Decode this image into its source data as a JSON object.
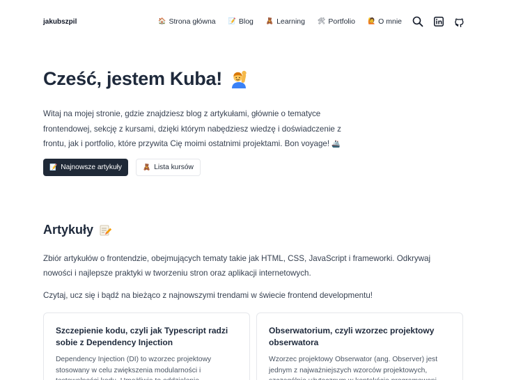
{
  "header": {
    "brand": "jakubszpil",
    "nav": [
      {
        "label": "Strona główna",
        "icon": "house-icon",
        "emoji": "🏠"
      },
      {
        "label": "Blog",
        "icon": "memo-icon",
        "emoji": "📝"
      },
      {
        "label": "Learning",
        "icon": "teddy-bear-icon",
        "emoji": "🧸"
      },
      {
        "label": "Portfolio",
        "icon": "tools-icon",
        "emoji": "🛠"
      },
      {
        "label": "O mnie",
        "icon": "person-icon",
        "emoji": "🙋"
      }
    ],
    "icons": [
      "search-icon",
      "linkedin-icon",
      "github-icon"
    ]
  },
  "hero": {
    "title": "Cześć, jestem Kuba!",
    "title_emoji": "🙋‍♂️",
    "text": "Witaj na mojej stronie, gdzie znajdziesz blog z artykułami, głównie o tematyce frontendowej, sekcję z kursami, dzięki którym nabędziesz wiedzę i doświadczenie z frontu, jak i portfolio, które przywita Cię moimi ostatnimi projektami. Bon voyage!",
    "text_emoji": "🚢",
    "buttons": {
      "primary": {
        "label": "Najnowsze artykuły",
        "emoji": "📝"
      },
      "secondary": {
        "label": "Lista kursów",
        "emoji": "🧸"
      }
    }
  },
  "articles": {
    "title": "Artykuły",
    "title_emoji": "📝",
    "description": "Zbiór artykułów o frontendzie, obejmujących tematy takie jak HTML, CSS, JavaScript i frameworki. Odkrywaj nowości i najlepsze praktyki w tworzeniu stron oraz aplikacji internetowych.",
    "description2": "Czytaj, ucz się i bądź na bieżąco z najnowszymi trendami w świecie frontend developmentu!",
    "cards": [
      {
        "title": "Szczepienie kodu, czyli jak Typescript radzi sobie z Dependency Injection",
        "desc": "Dependency Injection (DI) to wzorzec projektowy stosowany w celu zwiększenia modularności i testowalności kodu. Umożliwia to oddzielenie..."
      },
      {
        "title": "Obserwatorium, czyli wzorzec projektowy obserwatora",
        "desc": "Wzorzec projektowy Obserwator (ang. Observer) jest jednym z najważniejszych wzorców projektowych, szczególnie użytecznym w kontekście programowani..."
      }
    ]
  },
  "colors": {
    "text_dark": "#1e293b",
    "button_dark": "#1f2937",
    "border": "#e5e7eb"
  }
}
